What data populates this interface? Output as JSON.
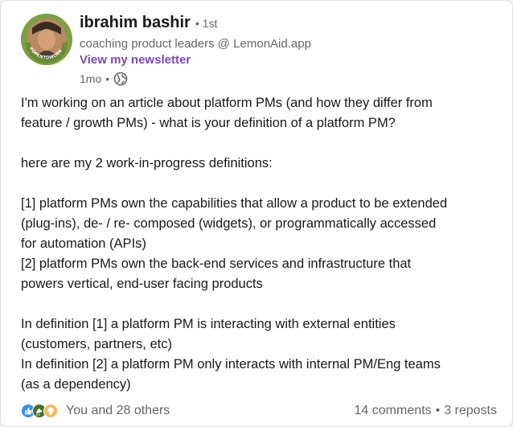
{
  "author": {
    "name": "ibrahim bashir",
    "degree_sep": "•",
    "degree": "1st",
    "headline": "coaching product leaders @ LemonAid.app",
    "newsletter": "View my newsletter",
    "avatar_ring_text": "#OPENTOWORK"
  },
  "post_meta": {
    "time": "1mo",
    "separator": "•"
  },
  "post": {
    "p1": "I'm working on an article about platform PMs (and how they differ from\nfeature / growth PMs) - what is your definition of a platform PM?",
    "p2": "here are my 2 work-in-progress definitions:",
    "p3_1": "[1] platform PMs own the capabilities that allow a product to be extended\n(plug-ins), de- / re- composed (widgets), or programmatically accessed\nfor automation (APIs)",
    "p3_2": "[2] platform PMs own the back-end services and infrastructure that\npowers vertical, end-user facing products",
    "p4_1": "In definition [1] a platform PM is interacting with external entities\n(customers, partners, etc)",
    "p4_2": "In definition [2] a platform PM only interacts with internal PM/Eng teams\n(as a dependency)"
  },
  "social": {
    "reactions_text": "You and 28 others",
    "comments": "14 comments",
    "separator": "•",
    "reposts": "3 reposts"
  },
  "colors": {
    "newsletter": "#7a4bb5",
    "muted": "#666666",
    "open_to_work": "#7f9f46"
  },
  "icons": [
    "globe-icon",
    "like-reaction-icon",
    "celebrate-reaction-icon",
    "insightful-reaction-icon"
  ]
}
